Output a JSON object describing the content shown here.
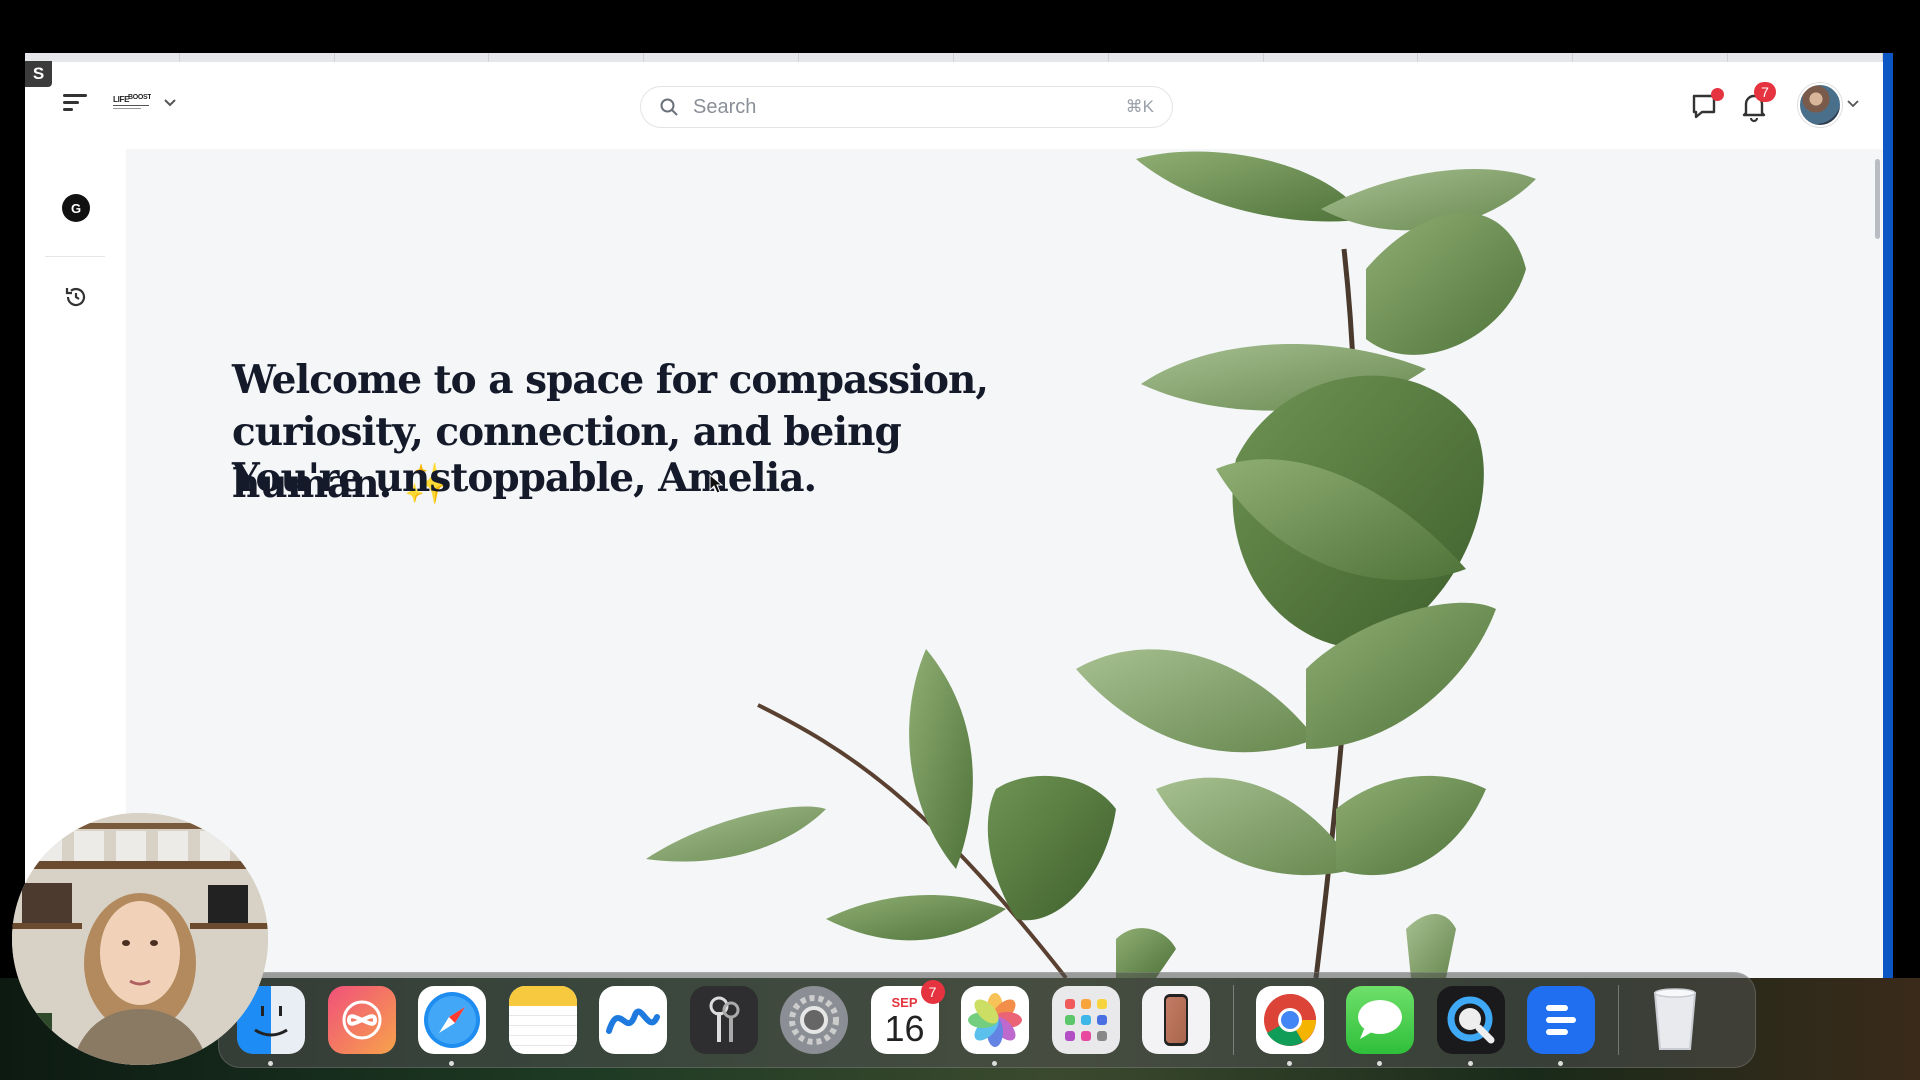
{
  "app": {
    "badge_letter": "S",
    "logo_text": "LIFEBOOST"
  },
  "search": {
    "placeholder": "Search",
    "shortcut": "⌘K"
  },
  "header": {
    "notifications_count": "7"
  },
  "sidebar": {
    "workspace_initial": "G"
  },
  "main": {
    "welcome_text": "Welcome to a space for compassion, curiosity, connection, and being human.",
    "sparkle": "✨",
    "affirmation": "You're unstoppable, Amelia."
  },
  "dock": {
    "calendar": {
      "month": "SEP",
      "day": "16",
      "badge": "7"
    },
    "items": [
      {
        "name": "finder",
        "running": true
      },
      {
        "name": "affinity",
        "running": false
      },
      {
        "name": "safari",
        "running": true
      },
      {
        "name": "notes",
        "running": true
      },
      {
        "name": "freeform",
        "running": false
      },
      {
        "name": "keychain-access",
        "running": false
      },
      {
        "name": "system-settings",
        "running": false
      },
      {
        "name": "calendar",
        "running": false
      },
      {
        "name": "photos",
        "running": true
      },
      {
        "name": "launchpad",
        "running": false
      },
      {
        "name": "iphone-mirroring",
        "running": false
      },
      {
        "name": "chrome",
        "running": true
      },
      {
        "name": "messages",
        "running": true
      },
      {
        "name": "quicktime",
        "running": true
      },
      {
        "name": "text-app",
        "running": true
      },
      {
        "name": "trash",
        "running": false
      }
    ]
  },
  "colors": {
    "accent_red": "#e5343f",
    "heading": "#141a2a",
    "leaf": "#5b7f45"
  }
}
